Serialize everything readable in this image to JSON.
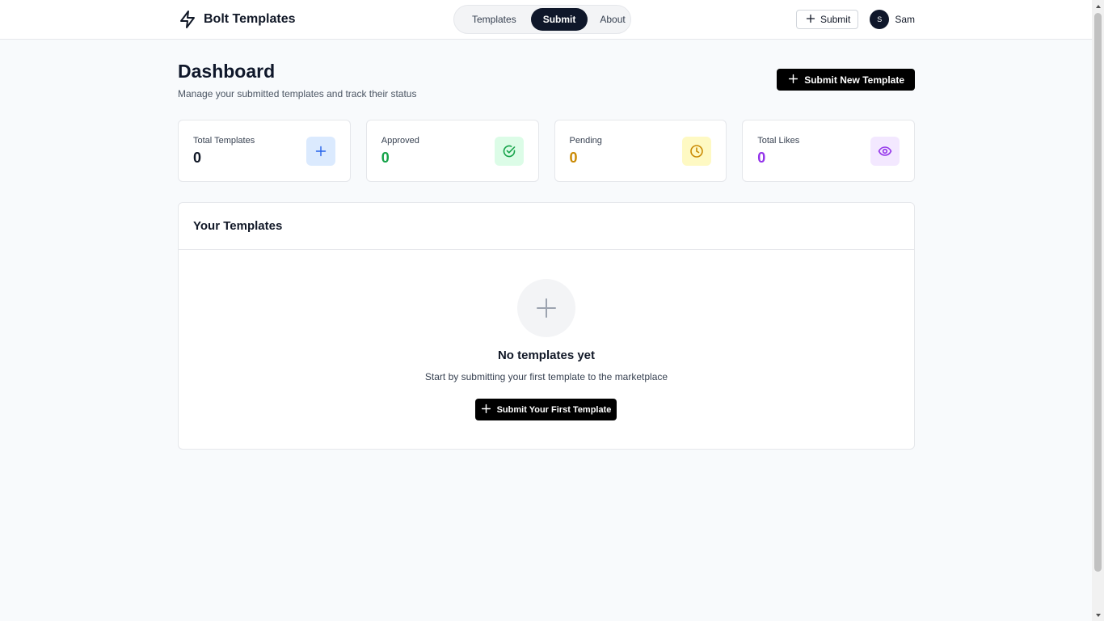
{
  "header": {
    "brand_name": "Bolt Templates",
    "brand_icon": "lightning-bolt-icon",
    "nav": [
      {
        "label": "Templates",
        "active": false
      },
      {
        "label": "Submit",
        "active": true
      },
      {
        "label": "About",
        "active": false
      }
    ],
    "submit_label": "Submit",
    "user": {
      "initial": "S",
      "name": "Sam"
    }
  },
  "main": {
    "title": "Dashboard",
    "subtitle": "Manage your submitted templates and track their status",
    "new_template_label": "Submit New Template",
    "stats": [
      {
        "label": "Total Templates",
        "value": "0",
        "color": "#111827",
        "icon": "plus-icon",
        "icon_bg": "#dbeafe",
        "icon_color": "#2563eb"
      },
      {
        "label": "Approved",
        "value": "0",
        "color": "#16a34a",
        "icon": "check-circle-icon",
        "icon_bg": "#dcfce7",
        "icon_color": "#16a34a"
      },
      {
        "label": "Pending",
        "value": "0",
        "color": "#ca8a04",
        "icon": "clock-icon",
        "icon_bg": "#fef9c3",
        "icon_color": "#ca8a04"
      },
      {
        "label": "Total Likes",
        "value": "0",
        "color": "#9333ea",
        "icon": "eye-icon",
        "icon_bg": "#f3e8ff",
        "icon_color": "#9333ea"
      }
    ],
    "templates": {
      "title": "Your Templates",
      "empty_title": "No templates yet",
      "empty_subtitle": "Start by submitting your first template to the marketplace",
      "first_button_label": "Submit Your First Template"
    }
  }
}
